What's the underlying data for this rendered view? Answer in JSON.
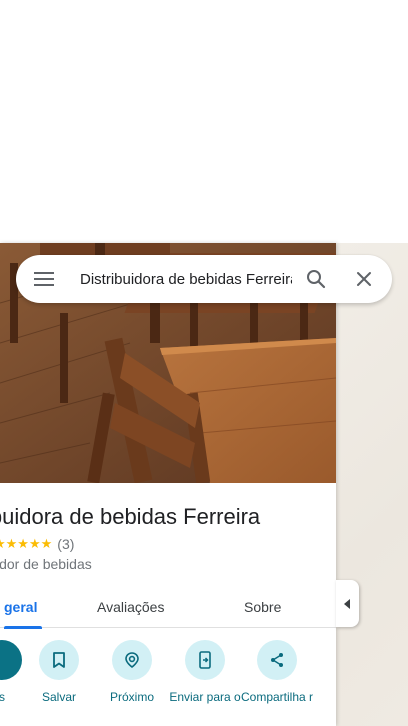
{
  "search": {
    "query": "Distribuidora de bebidas Ferreira",
    "menu_icon": "menu-icon",
    "search_icon": "search-icon",
    "close_icon": "close-icon"
  },
  "place": {
    "name": "Distribuidora de bebidas Ferreira",
    "name_visible": "ibuidora de bebidas Ferreira",
    "rating": 5,
    "rating_stars": "★★★★★",
    "review_count": "(3)",
    "category": "idor de bebidas"
  },
  "tabs": [
    {
      "label": "geral",
      "active": true
    },
    {
      "label": "Avaliações",
      "active": false
    },
    {
      "label": "Sobre",
      "active": false
    }
  ],
  "actions": [
    {
      "label": "s",
      "icon": "directions-icon"
    },
    {
      "label": "Salvar",
      "icon": "bookmark-icon"
    },
    {
      "label": "Próximo",
      "icon": "nearby-icon"
    },
    {
      "label": "Enviar para o",
      "icon": "send-to-phone-icon"
    },
    {
      "label": "Compartilha r",
      "icon": "share-icon"
    }
  ],
  "colors": {
    "accent": "#1a73e8",
    "action_bg": "#d2f0f5",
    "action_fg": "#0b6b7e",
    "star": "#fbbc04"
  }
}
